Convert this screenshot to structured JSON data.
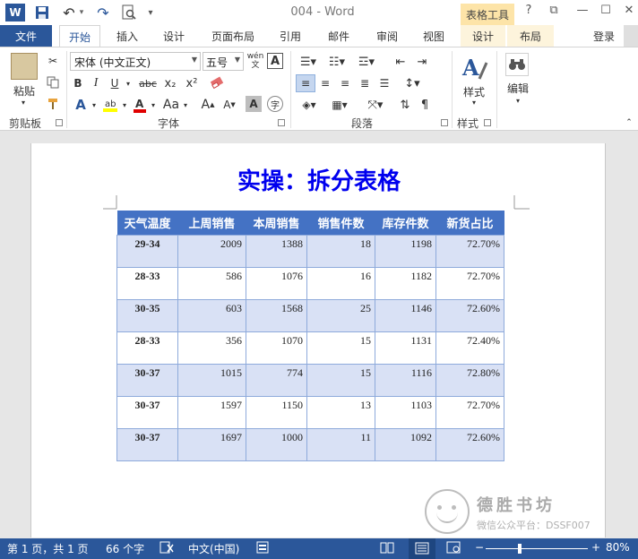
{
  "titlebar": {
    "word_logo": "W",
    "title": "004 - Word",
    "context_tab": "表格工具",
    "help": "?",
    "restore": "⧉",
    "minimize": "—",
    "maximize": "☐",
    "close": "✕"
  },
  "tabs": {
    "file": "文件",
    "home": "开始",
    "insert": "插入",
    "design": "设计",
    "layout": "页面布局",
    "references": "引用",
    "mailings": "邮件",
    "review": "审阅",
    "view": "视图",
    "table_design": "设计",
    "table_layout": "布局",
    "login": "登录"
  },
  "ribbon": {
    "paste": "粘贴",
    "font_name": "宋体 (中文正文)",
    "font_size": "五号",
    "wen": "wén",
    "wen_char": "文",
    "style_label": "样式",
    "edit_label": "编辑",
    "groups": {
      "clipboard": "剪贴板",
      "font": "字体",
      "paragraph": "段落",
      "styles": "样式"
    }
  },
  "document": {
    "heading": "实操：拆分表格",
    "headers": [
      "天气温度",
      "上周销售",
      "本周销售",
      "销售件数",
      "库存件数",
      "新货占比"
    ],
    "rows": [
      [
        "29-34",
        "2009",
        "1388",
        "18",
        "1198",
        "72.70%"
      ],
      [
        "28-33",
        "586",
        "1076",
        "16",
        "1182",
        "72.70%"
      ],
      [
        "30-35",
        "603",
        "1568",
        "25",
        "1146",
        "72.60%"
      ],
      [
        "28-33",
        "356",
        "1070",
        "15",
        "1131",
        "72.40%"
      ],
      [
        "30-37",
        "1015",
        "774",
        "15",
        "1116",
        "72.80%"
      ],
      [
        "30-37",
        "1597",
        "1150",
        "13",
        "1103",
        "72.70%"
      ],
      [
        "30-37",
        "1697",
        "1000",
        "11",
        "1092",
        "72.60%"
      ]
    ]
  },
  "watermark": {
    "name": "德胜书坊",
    "sub": "微信公众平台：DSSF007"
  },
  "statusbar": {
    "page": "第 1 页，共 1 页",
    "words": "66 个字",
    "language": "中文(中国)",
    "zoom_minus": "−",
    "zoom_plus": "+",
    "zoom": "80%"
  },
  "colors": {
    "accent": "#2b579a",
    "header_fill": "#4472c4",
    "band_fill": "#d9e1f5",
    "heading": "#0000ee"
  }
}
